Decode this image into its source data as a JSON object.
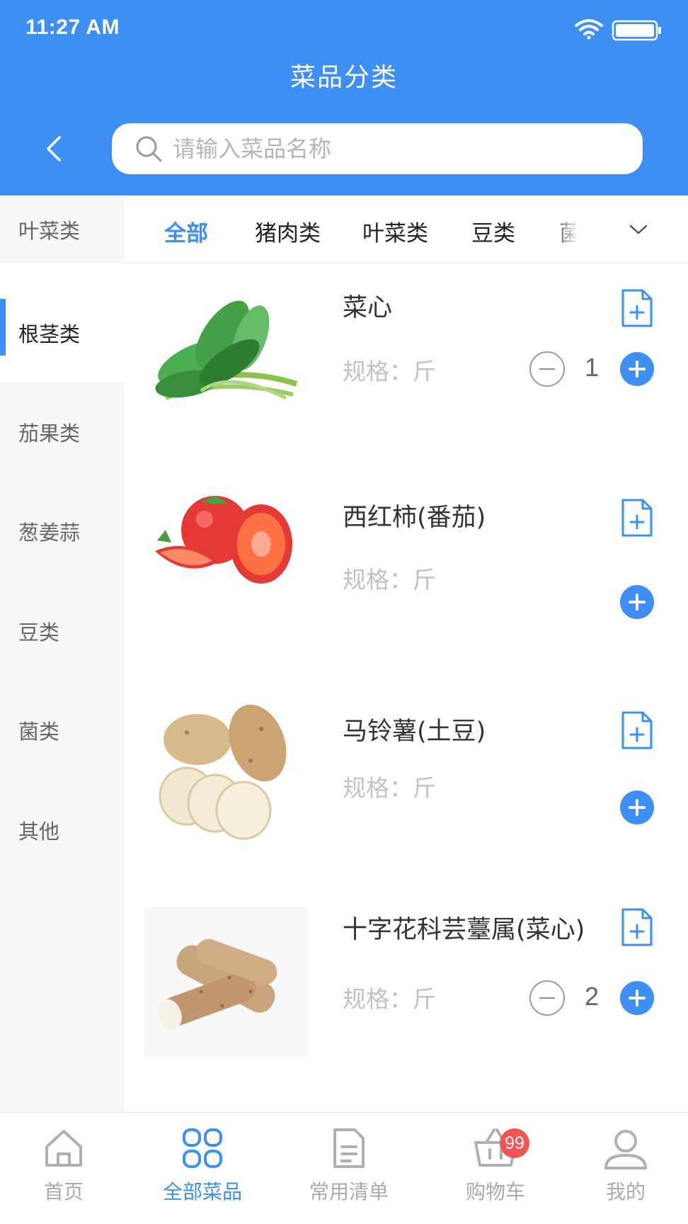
{
  "status_bar": {
    "time": "11:27 AM"
  },
  "header": {
    "title": "菜品分类",
    "search_placeholder": "请输入菜品名称"
  },
  "sidebar": {
    "items": [
      {
        "label": "叶菜类"
      },
      {
        "label": "根茎类",
        "active": true
      },
      {
        "label": "茄果类"
      },
      {
        "label": "葱姜蒜"
      },
      {
        "label": "豆类"
      },
      {
        "label": "菌类"
      },
      {
        "label": "其他"
      }
    ]
  },
  "tabs": {
    "items": [
      {
        "label": "全部",
        "active": true
      },
      {
        "label": "猪肉类"
      },
      {
        "label": "叶菜类"
      },
      {
        "label": "豆类"
      },
      {
        "label": "菌"
      }
    ]
  },
  "products": [
    {
      "name": "菜心",
      "spec": "规格：斤",
      "quantity": "1",
      "image": "choy-sum"
    },
    {
      "name": "西红柿(番茄)",
      "spec": "规格：斤",
      "quantity": "",
      "image": "tomato"
    },
    {
      "name": " 马铃薯(土豆)",
      "spec": "规格：斤",
      "quantity": "",
      "image": "potato"
    },
    {
      "name": "十字花科芸薹属(菜心)",
      "spec": "规格：斤",
      "quantity": "2",
      "image": "yam"
    }
  ],
  "bottom_nav": {
    "items": [
      {
        "label": "首页",
        "icon": "home-icon"
      },
      {
        "label": "全部菜品",
        "icon": "grid-icon",
        "active": true
      },
      {
        "label": "常用清单",
        "icon": "list-icon"
      },
      {
        "label": "购物车",
        "icon": "basket-icon",
        "badge": "99"
      },
      {
        "label": "我的",
        "icon": "user-icon"
      }
    ]
  },
  "colors": {
    "primary": "#3d8ff5",
    "badge": "#f45454",
    "sidebar_bg": "#f7f7f7",
    "muted_text": "#aaaaaa"
  }
}
